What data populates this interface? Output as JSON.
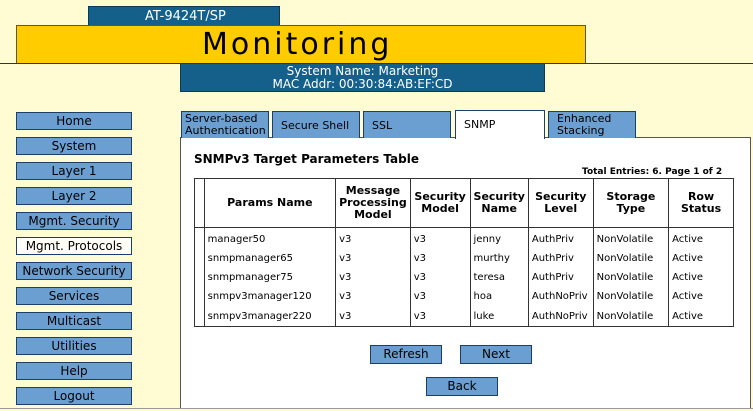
{
  "header": {
    "device": "AT-9424T/SP",
    "title": "Monitoring",
    "system_name": "System Name: Marketing",
    "mac_addr": "MAC Addr: 00:30:84:AB:EF:CD"
  },
  "sidebar": {
    "items": [
      {
        "label": "Home"
      },
      {
        "label": "System"
      },
      {
        "label": "Layer 1"
      },
      {
        "label": "Layer 2"
      },
      {
        "label": "Mgmt. Security"
      },
      {
        "label": "Mgmt. Protocols",
        "active": true
      },
      {
        "label": "Network Security"
      },
      {
        "label": "Services"
      },
      {
        "label": "Multicast"
      },
      {
        "label": "Utilities"
      },
      {
        "label": "Help"
      },
      {
        "label": "Logout"
      }
    ]
  },
  "tabs": [
    {
      "label": "Server-based Authentication"
    },
    {
      "label": "Secure Shell"
    },
    {
      "label": "SSL"
    },
    {
      "label": "SNMP",
      "active": true
    },
    {
      "label": "Enhanced Stacking"
    }
  ],
  "main": {
    "table_title": "SNMPv3 Target Parameters Table",
    "total_entries": "Total Entries: 6. Page 1 of 2",
    "columns": [
      "Params Name",
      "Message Processing Model",
      "Security Model",
      "Security Name",
      "Security Level",
      "Storage Type",
      "Row Status"
    ],
    "rows": [
      [
        "manager50",
        "v3",
        "v3",
        "jenny",
        "AuthPriv",
        "NonVolatile",
        "Active"
      ],
      [
        "snmpmanager65",
        "v3",
        "v3",
        "murthy",
        "AuthPriv",
        "NonVolatile",
        "Active"
      ],
      [
        "snmpmanager75",
        "v3",
        "v3",
        "teresa",
        "AuthPriv",
        "NonVolatile",
        "Active"
      ],
      [
        "snmpv3manager120",
        "v3",
        "v3",
        "hoa",
        "AuthNoPriv",
        "NonVolatile",
        "Active"
      ],
      [
        "snmpv3manager220",
        "v3",
        "v3",
        "luke",
        "AuthNoPriv",
        "NonVolatile",
        "Active"
      ]
    ],
    "refresh_label": "Refresh",
    "next_label": "Next",
    "back_label": "Back"
  }
}
